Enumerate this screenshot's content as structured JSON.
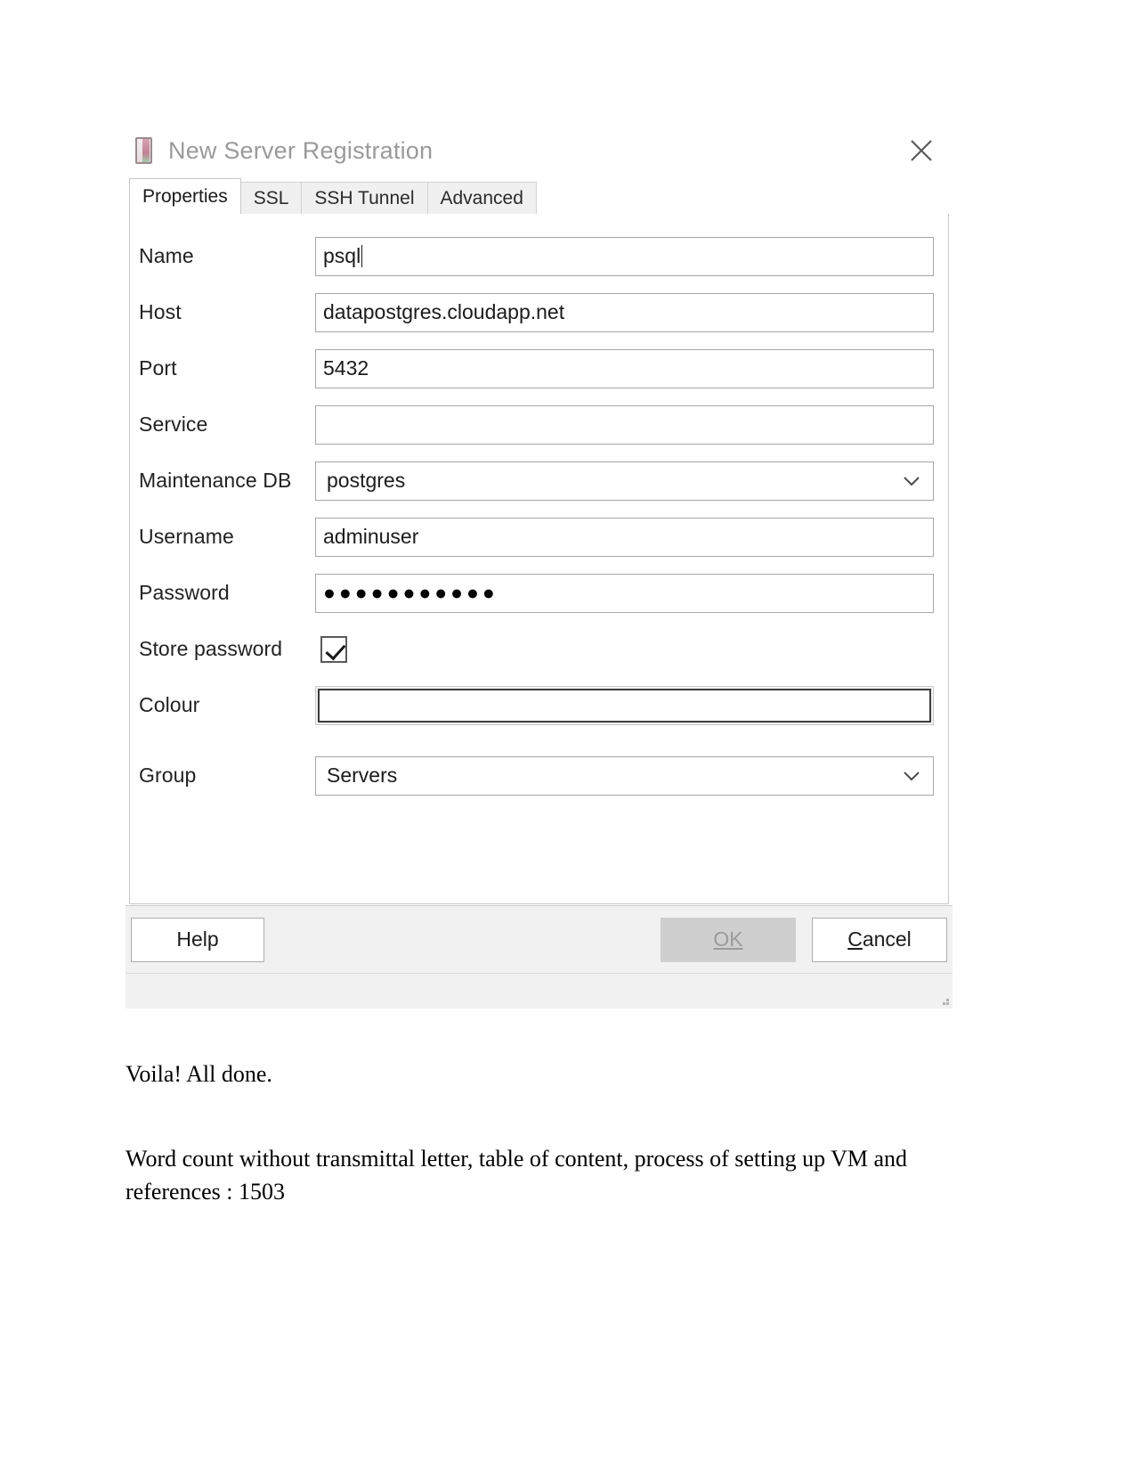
{
  "dialog": {
    "title": "New Server Registration",
    "title_icon": "server-icon",
    "close_icon": "close-icon",
    "tabs": [
      {
        "label": "Properties",
        "active": true
      },
      {
        "label": "SSL",
        "active": false
      },
      {
        "label": "SSH Tunnel",
        "active": false
      },
      {
        "label": "Advanced",
        "active": false
      }
    ],
    "fields": {
      "name": {
        "label": "Name",
        "value": "psql"
      },
      "host": {
        "label": "Host",
        "value": "datapostgres.cloudapp.net"
      },
      "port": {
        "label": "Port",
        "value": "5432"
      },
      "service": {
        "label": "Service",
        "value": ""
      },
      "maintenance_db": {
        "label": "Maintenance DB",
        "value": "postgres",
        "chevron": "chevron-down-icon"
      },
      "username": {
        "label": "Username",
        "value": "adminuser"
      },
      "password": {
        "label": "Password",
        "value": "●●●●●●●●●●●"
      },
      "store_password": {
        "label": "Store password",
        "checked": true
      },
      "colour": {
        "label": "Colour",
        "value": ""
      },
      "group": {
        "label": "Group",
        "value": "Servers",
        "chevron": "chevron-down-icon"
      }
    },
    "buttons": {
      "help": {
        "label": "Help",
        "enabled": true
      },
      "ok": {
        "label": "OK",
        "mnemonic": "O",
        "enabled": false
      },
      "cancel": {
        "label": "Cancel",
        "mnemonic": "C",
        "enabled": true
      }
    }
  },
  "document": {
    "line_voila": "Voila! All done.",
    "para_wordcount": "Word count without transmittal letter, table of content, process of setting up VM and references : 1503"
  },
  "colors": {
    "title_text": "#9a9a9a",
    "dialog_bg": "#ffffff",
    "panel_border": "#c9c9c9",
    "field_border": "#a6a6a6",
    "button_bar_bg": "#f1f1f1",
    "disabled_button_bg": "#cfcfcf",
    "disabled_button_text": "#9b9b9b"
  }
}
